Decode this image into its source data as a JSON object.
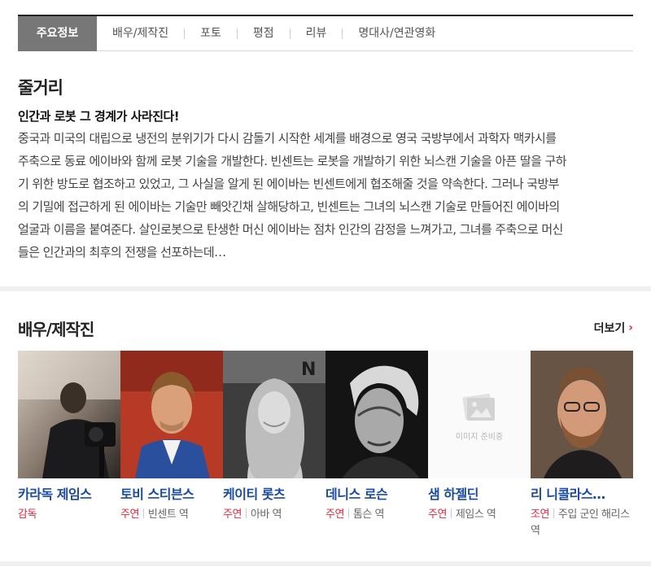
{
  "tabs": [
    {
      "label": "주요정보",
      "active": true
    },
    {
      "label": "배우/제작진"
    },
    {
      "label": "포토"
    },
    {
      "label": "평점"
    },
    {
      "label": "리뷰"
    },
    {
      "label": "명대사/연관영화"
    }
  ],
  "synopsis": {
    "title": "줄거리",
    "tagline": "인간과 로봇 그 경계가 사라진다!",
    "lines": [
      "중국과 미국의 대립으로 냉전의 분위기가 다시 감돌기 시작한 세계를 배경으로 영국 국방부에서 과학자 맥카시를",
      "주축으로 동료 에이바와 함께 로봇 기술을 개발한다. 빈센트는 로봇을 개발하기 위한 뇌스캔 기술을 아픈 딸을 구하",
      "기 위한 방도로 협조하고 있었고, 그 사실을 알게 된 에이바는 빈센트에게 협조해줄 것을 약속한다. 그러나 국방부",
      "의 기밀에 접근하게 된 에이바는 기술만 빼앗긴채 살해당하고, 빈센트는 그녀의 뇌스캔 기술로 만들어진 에이바의",
      "얼굴과 이름을 붙여준다. 살인로봇으로 탄생한 머신 에이바는 점차 인간의 감정을 느껴가고, 그녀를 주축으로 머신",
      "들은 인간과의 최후의 전쟁을 선포하는데…"
    ]
  },
  "cast_section": {
    "title": "배우/제작진",
    "more_label": "더보기",
    "more_icon": "chevron-right-icon",
    "placeholder_text": "이미지 준비중",
    "items": [
      {
        "name": "카라독 제임스",
        "role_kind": "감독",
        "role_detail": ""
      },
      {
        "name": "토비 스티븐스",
        "role_kind": "주연",
        "role_detail": "빈센트 역"
      },
      {
        "name": "케이티 롯츠",
        "role_kind": "주연",
        "role_detail": "아바 역"
      },
      {
        "name": "데니스 로슨",
        "role_kind": "주연",
        "role_detail": "톰슨 역"
      },
      {
        "name": "샘 하젤딘",
        "role_kind": "주연",
        "role_detail": "제임스 역"
      },
      {
        "name": "리 니콜라스…",
        "role_kind": "조연",
        "role_detail": "주입 군인 해리스 역"
      }
    ]
  },
  "colors": {
    "accent_red": "#e2283f",
    "name_blue": "#1a4ba0",
    "tab_active_bg": "#777777"
  }
}
